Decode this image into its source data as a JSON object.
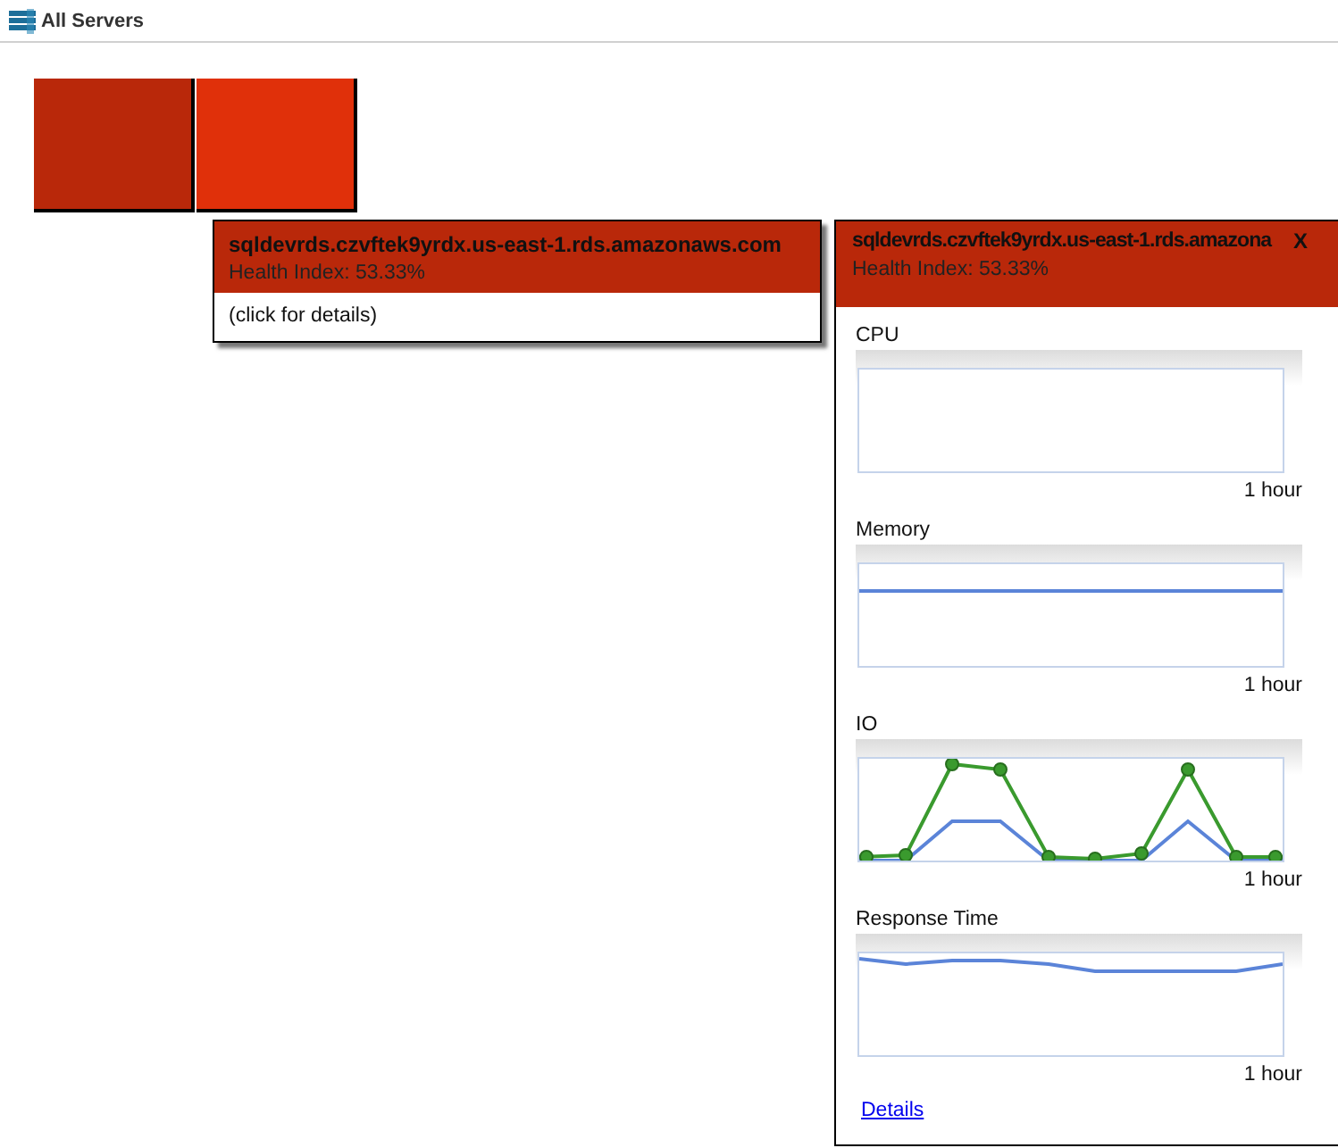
{
  "header": {
    "title": "All Servers"
  },
  "tiles": [
    {
      "color": "#b9280a"
    },
    {
      "color": "#e0300a"
    }
  ],
  "tooltip": {
    "server": "sqldevrds.czvftek9yrdx.us-east-1.rds.amazonaws.com",
    "health": "Health Index: 53.33%",
    "hint": "(click for details)"
  },
  "panel": {
    "server": "sqldevrds.czvftek9yrdx.us-east-1.rds.amazona",
    "close": "X",
    "health": "Health Index: 53.33%",
    "charts": [
      {
        "label": "CPU",
        "kind": "blank",
        "span": "1 hour"
      },
      {
        "label": "Memory",
        "kind": "flat",
        "span": "1 hour"
      },
      {
        "label": "IO",
        "kind": "dual",
        "span": "1 hour"
      },
      {
        "label": "Response Time",
        "kind": "wave",
        "span": "1 hour"
      }
    ],
    "link": "Details"
  }
}
